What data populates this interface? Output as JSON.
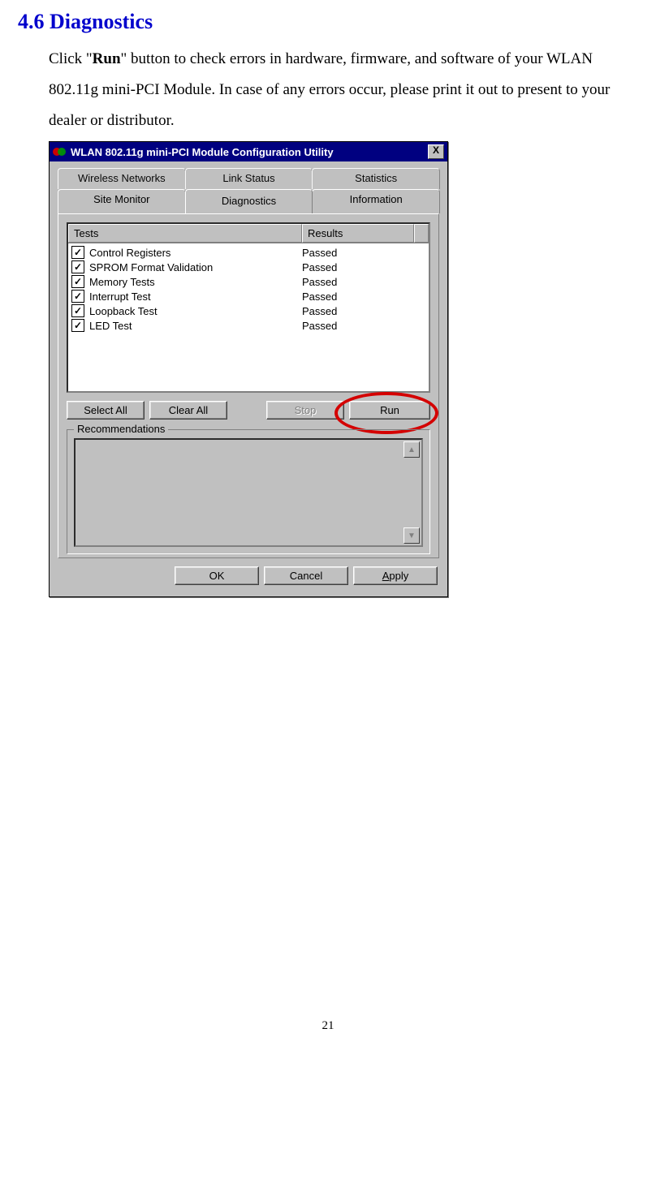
{
  "section_title": "4.6 Diagnostics",
  "paragraph": {
    "p1a": "Click \"",
    "p1_run": "Run",
    "p1b": "\" button to check errors in hardware, firmware, and software of your WLAN 802.11g mini-PCI Module.  In case of any errors occur, please print it out to present to your dealer or distributor."
  },
  "dialog": {
    "title": "WLAN 802.11g mini-PCI Module Configuration Utility",
    "close": "X",
    "tabs_back": [
      "Wireless Networks",
      "Link Status",
      "Statistics"
    ],
    "tabs_front": [
      "Site Monitor",
      "Diagnostics",
      "Information"
    ],
    "active_tab_index": 1,
    "columns": {
      "tests": "Tests",
      "results": "Results"
    },
    "tests": [
      {
        "checked": true,
        "name": "Control Registers",
        "result": "Passed"
      },
      {
        "checked": true,
        "name": "SPROM Format Validation",
        "result": "Passed"
      },
      {
        "checked": true,
        "name": "Memory Tests",
        "result": "Passed"
      },
      {
        "checked": true,
        "name": "Interrupt Test",
        "result": "Passed"
      },
      {
        "checked": true,
        "name": "Loopback Test",
        "result": "Passed"
      },
      {
        "checked": true,
        "name": "LED  Test",
        "result": "Passed"
      }
    ],
    "buttons": {
      "select_all": "Select All",
      "clear_all": "Clear All",
      "stop": "Stop",
      "run": "Run",
      "ok": "OK",
      "cancel": "Cancel",
      "apply_prefix": "A",
      "apply_rest": "pply"
    },
    "group": {
      "legend": "Recommendations"
    }
  },
  "page_number": "21"
}
